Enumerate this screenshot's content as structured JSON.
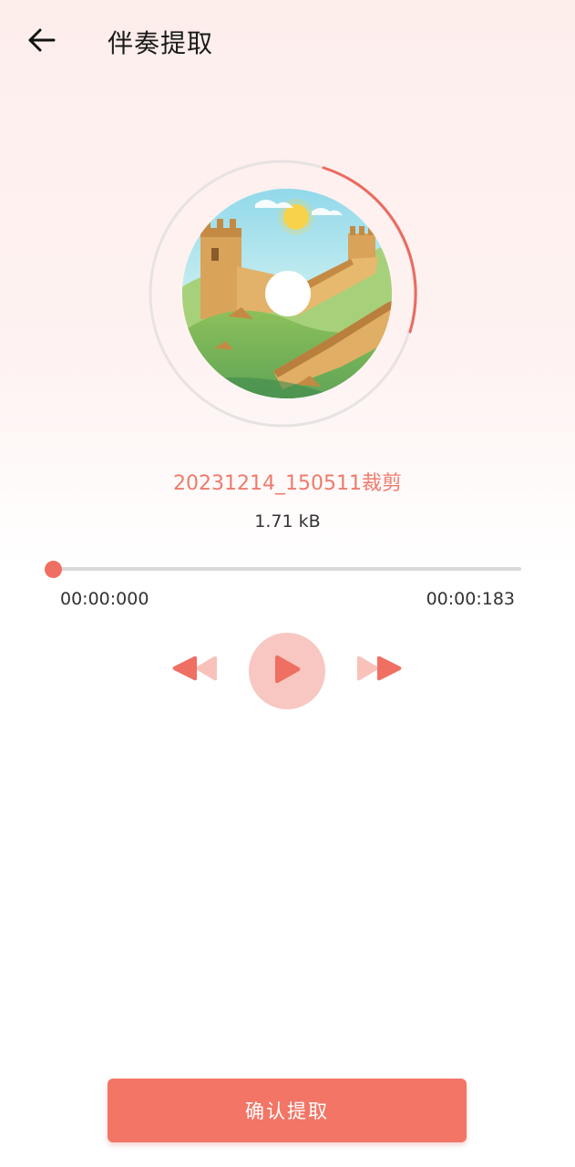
{
  "header": {
    "title": "伴奏提取",
    "back_icon": "arrow-left-icon"
  },
  "colors": {
    "accent": "#ef6f62",
    "accent_light": "#f8c7c1",
    "button": "#f27566"
  },
  "disc": {
    "artwork": "great-wall-landscape-illustration",
    "ring_progress_fraction": 0.2
  },
  "track": {
    "name": "20231214_150511裁剪",
    "size": "1.71 kB"
  },
  "playback": {
    "current_time": "00:00:000",
    "total_time": "00:00:183",
    "progress_fraction": 0.0,
    "prev_icon": "rewind-icon",
    "play_icon": "play-icon",
    "next_icon": "fast-forward-icon"
  },
  "footer": {
    "confirm_label": "确认提取"
  }
}
